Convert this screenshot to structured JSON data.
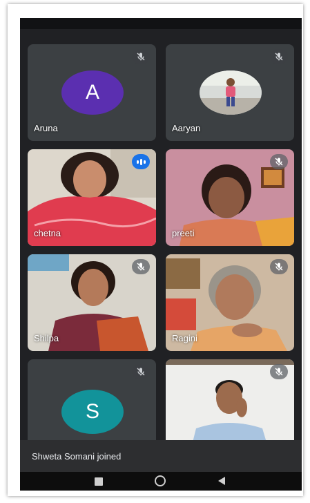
{
  "participants": [
    {
      "name": "Aruna",
      "avatar_letter": "A",
      "avatar_color": "#5b2fb0",
      "muted": true
    },
    {
      "name": "Aaryan",
      "muted": true
    },
    {
      "name": "chetna",
      "speaking": true
    },
    {
      "name": "preeti",
      "muted": true
    },
    {
      "name": "Shilpa",
      "muted": true
    },
    {
      "name": "Ragini",
      "muted": true
    },
    {
      "name": "",
      "avatar_letter": "S",
      "avatar_color": "#12939a",
      "muted": true
    },
    {
      "name": "",
      "muted": true
    }
  ],
  "notification": {
    "text": "Shweta Somani joined"
  },
  "colors": {
    "background": "#202124",
    "tile": "#3c4043",
    "speaking": "#1a73e8"
  },
  "navigation": {
    "buttons": [
      "recents-icon",
      "home-icon",
      "back-icon"
    ]
  }
}
